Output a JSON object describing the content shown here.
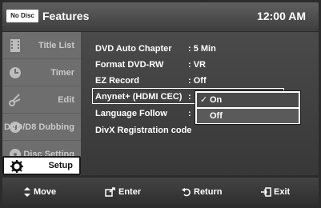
{
  "header": {
    "badge": "No Disc",
    "title": "Features",
    "clock": "12:00 AM"
  },
  "sidebar": {
    "items": [
      {
        "label": "Title List",
        "icon": "film-icon"
      },
      {
        "label": "Timer",
        "icon": "timer-icon"
      },
      {
        "label": "Edit",
        "icon": "scissors-icon"
      },
      {
        "label": "DVD/D8 Dubbing",
        "icon": "dubbing-icon"
      },
      {
        "label": "Disc Setting",
        "icon": "disc-icon"
      },
      {
        "label": "Setup",
        "icon": "gear-icon",
        "active": true
      }
    ]
  },
  "settings": [
    {
      "label": "DVD Auto Chapter",
      "value": ": 5 Min"
    },
    {
      "label": "Format DVD-RW",
      "value": ": VR"
    },
    {
      "label": "EZ Record",
      "value": ": Off"
    },
    {
      "label": "Anynet+ (HDMI CEC)",
      "value": ":"
    },
    {
      "label": "Language Follow",
      "value": ":"
    },
    {
      "label": "DivX Registration code",
      "value": ""
    }
  ],
  "dropdown": {
    "options": [
      {
        "label": "On",
        "checked": true
      },
      {
        "label": "Off",
        "checked": false
      }
    ],
    "check_glyph": "✓"
  },
  "footer": {
    "move": "Move",
    "enter": "Enter",
    "return": "Return",
    "exit": "Exit"
  }
}
